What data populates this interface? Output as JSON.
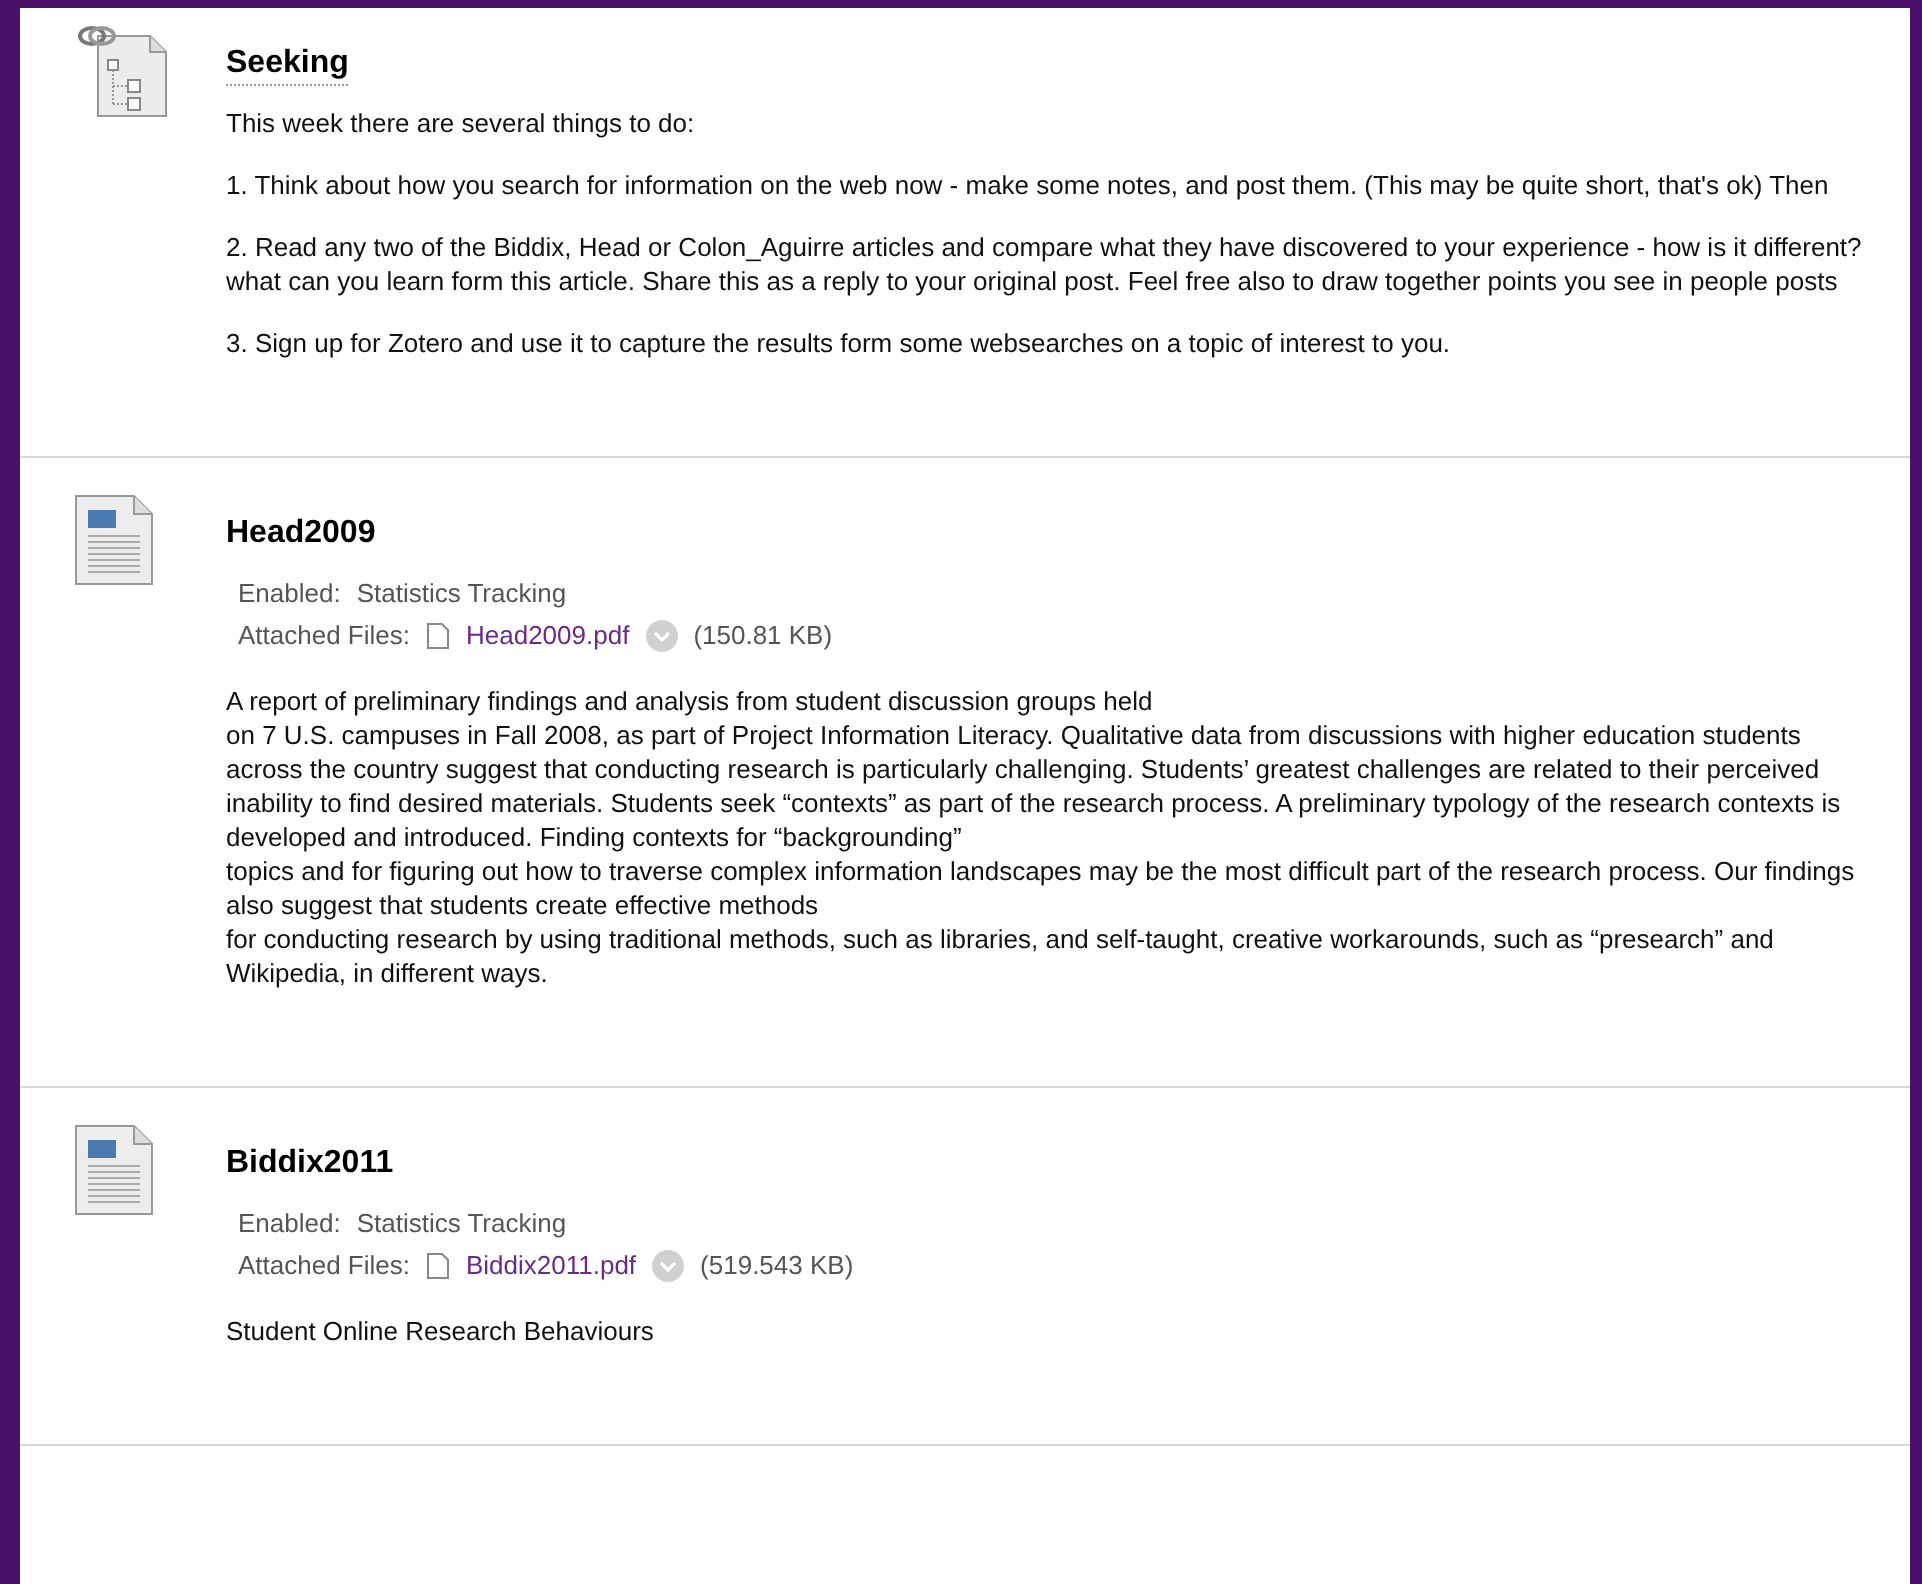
{
  "items": [
    {
      "kind": "folder",
      "title": "Seeking",
      "paragraphs": [
        "This week there are several things to do:",
        "1. Think about how you search for information on the web now - make some notes, and post them. (This may be quite short, that's ok) Then",
        "2. Read any two of the Biddix, Head or Colon_Aguirre articles and compare what they have discovered to your experience - how is it different? what can you learn form this article. Share this as a reply to your original post. Feel free also to draw together points you see in people posts",
        "3. Sign up for Zotero and use it to capture the results form some websearches on a topic of interest to you."
      ]
    },
    {
      "kind": "file",
      "title": "Head2009",
      "enabled_label": "Enabled:",
      "enabled_value": "Statistics Tracking",
      "files_label": "Attached Files:",
      "file_name": "Head2009.pdf",
      "file_size": "(150.81 KB)",
      "paragraphs": [
        "A report of preliminary findings and analysis from student discussion groups held\non 7 U.S. campuses in Fall 2008, as part of Project Information Literacy. Qualitative data from discussions with higher education students across the country suggest that conducting research is particularly challenging. Students’ greatest challenges are related to their perceived inability to find desired materials. Students seek “contexts” as part of the research process. A preliminary typology of the research contexts is developed and introduced. Finding contexts for “backgrounding”\ntopics and for figuring out how to traverse complex information landscapes may be the most difficult part of the research process. Our findings also suggest that students create effective methods\nfor conducting research by using traditional methods, such as libraries, and self-taught, creative workarounds, such as “presearch” and Wikipedia, in different ways."
      ]
    },
    {
      "kind": "file",
      "title": "Biddix2011",
      "enabled_label": "Enabled:",
      "enabled_value": "Statistics Tracking",
      "files_label": "Attached Files:",
      "file_name": "Biddix2011.pdf",
      "file_size": "(519.543 KB)",
      "paragraphs": [
        "Student Online Research Behaviours"
      ]
    }
  ]
}
